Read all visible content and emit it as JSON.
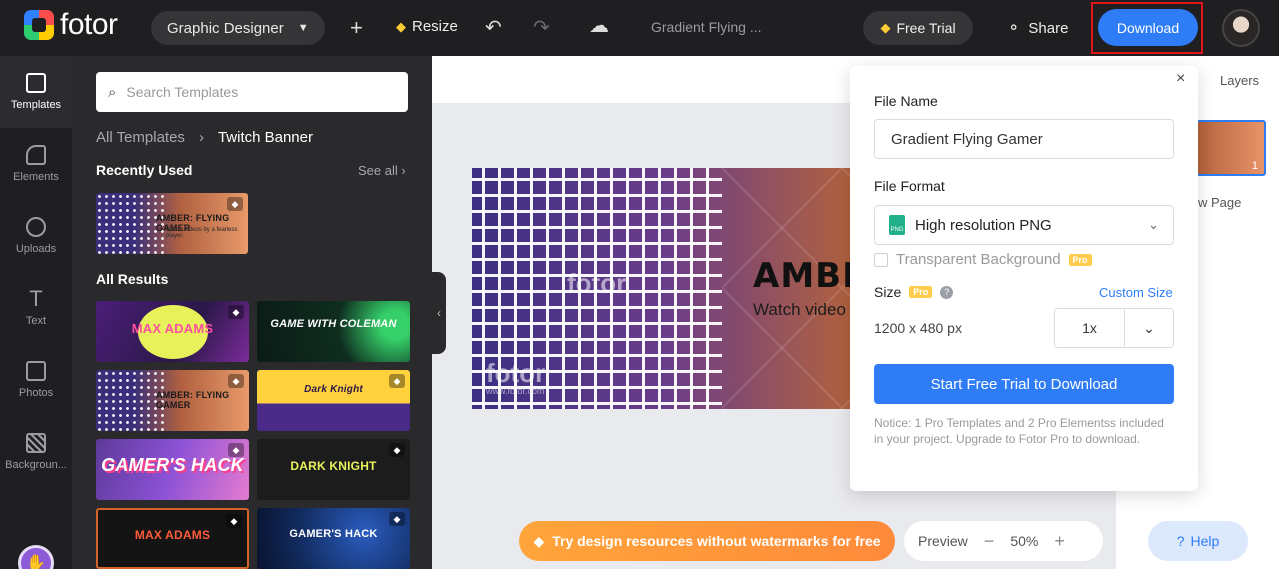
{
  "topbar": {
    "logo_text": "fotor",
    "design_type": "Graphic Designer",
    "resize_label": "Resize",
    "doc_title": "Gradient Flying ...",
    "free_trial_label": "Free Trial",
    "share_label": "Share",
    "download_label": "Download"
  },
  "rail": {
    "items": [
      {
        "label": "Templates",
        "icon": "templates-icon"
      },
      {
        "label": "Elements",
        "icon": "elements-icon"
      },
      {
        "label": "Uploads",
        "icon": "uploads-icon"
      },
      {
        "label": "Text",
        "icon": "text-icon"
      },
      {
        "label": "Photos",
        "icon": "photos-icon"
      },
      {
        "label": "Backgroun..."
      }
    ]
  },
  "panel": {
    "search_placeholder": "Search Templates",
    "breadcrumb_root": "All Templates",
    "breadcrumb_current": "Twitch Banner",
    "recently_used_title": "Recently Used",
    "see_all": "See all",
    "all_results_title": "All Results",
    "recent_thumb": {
      "title": "AMBER: FLYING GAMER",
      "subtitle": "Watch videos by a fearless player."
    },
    "results": [
      {
        "title": "MAX ADAMS"
      },
      {
        "title": "GAME WITH COLEMAN"
      },
      {
        "title": "AMBER: FLYING GAMER"
      },
      {
        "title": "Dark Knight"
      },
      {
        "title": "GAMER'S HACK"
      },
      {
        "title": "DARK KNIGHT"
      },
      {
        "title": "MAX ADAMS"
      },
      {
        "title": "GAMER'S HACK"
      }
    ]
  },
  "canvas": {
    "banner_title": "AMBER:",
    "banner_subtitle": "Watch video",
    "watermark": "fotor",
    "watermark_url": "www.fotor.com"
  },
  "bottom": {
    "promo_text": "Try design resources without watermarks for free",
    "preview_label": "Preview",
    "zoom_value": "50%",
    "help_label": "Help"
  },
  "pages": {
    "layers_tab": "Layers",
    "page_number": "1",
    "new_page_label": "w Page"
  },
  "download_popover": {
    "file_name_label": "File Name",
    "file_name_value": "Gradient Flying Gamer",
    "file_format_label": "File Format",
    "file_format_value": "High resolution PNG",
    "transparent_label": "Transparent Background",
    "pro_badge": "Pro",
    "size_label": "Size",
    "custom_size_label": "Custom Size",
    "dimensions": "1200 x 480 px",
    "scale_value": "1x",
    "start_button": "Start Free Trial to Download",
    "notice": "Notice: 1 Pro Templates and 2 Pro Elementss included in your project. Upgrade to Fotor Pro to download."
  },
  "colors": {
    "accent": "#2f7df6",
    "dark_bg": "#1f1f22",
    "highlight": "#e1151b",
    "promo": "#ff9a3a"
  }
}
